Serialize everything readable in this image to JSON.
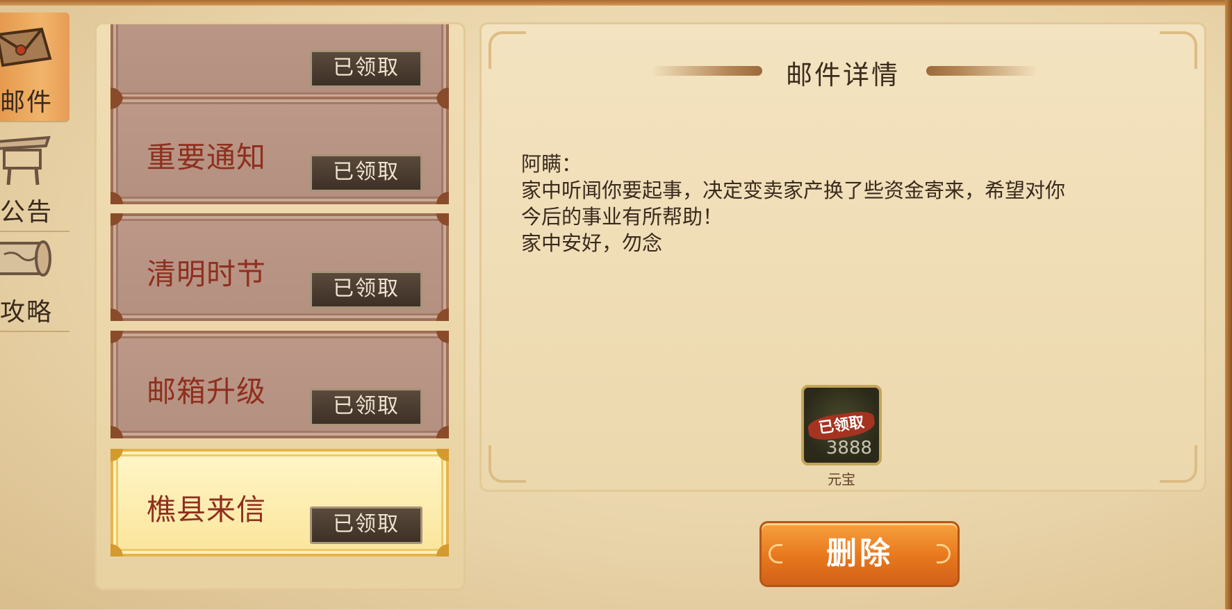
{
  "sidebar": {
    "items": [
      {
        "label": "邮件",
        "icon": "envelope-icon",
        "active": true
      },
      {
        "label": "公告",
        "icon": "notice-board-icon",
        "active": false
      },
      {
        "label": "攻略",
        "icon": "scroll-icon",
        "active": false
      }
    ]
  },
  "mail_list": {
    "items": [
      {
        "title": "",
        "status": "已领取"
      },
      {
        "title": "重要通知",
        "status": "已领取"
      },
      {
        "title": "清明时节",
        "status": "已领取"
      },
      {
        "title": "邮箱升级",
        "status": "已领取"
      },
      {
        "title": "樵县来信",
        "status": "已领取"
      }
    ],
    "selected_index": 4
  },
  "detail": {
    "title": "邮件详情",
    "body_lines": [
      "阿瞒：",
      "家中听闻你要起事，决定变卖家产换了些资金寄来，希望对你",
      "今后的事业有所帮助！",
      "家中安好，勿念"
    ],
    "reward": {
      "stamp": "已领取",
      "count": "3888",
      "name": "元宝",
      "icon": "yuanbao-icon"
    }
  },
  "actions": {
    "delete_label": "删除"
  },
  "colors": {
    "selected_mail": "#fbe59b",
    "mail_item": "#b8937f",
    "accent_button": "#e7771d",
    "title_text": "#8f2f1e"
  }
}
